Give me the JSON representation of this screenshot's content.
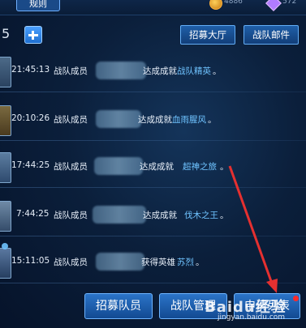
{
  "header": {
    "rules_label": "规则",
    "coins": "4886",
    "gems": "572"
  },
  "toolbar": {
    "count": "5",
    "recruit_hall_label": "招募大厅",
    "team_mail_label": "战队邮件"
  },
  "logs": [
    {
      "time": "21:45:13",
      "prefix": "战队成员",
      "suffix": "达成成就",
      "highlight": "战队精英",
      "end": "。"
    },
    {
      "time": "20:10:26",
      "prefix": "战队成员",
      "suffix": "达成成就",
      "highlight": "血雨腥风",
      "end": "。"
    },
    {
      "time": "17:44:25",
      "prefix": "战队成员",
      "suffix": "达成成就",
      "highlight": "超神之旅",
      "end": "。"
    },
    {
      "time": "7:44:25",
      "prefix": "战队成员",
      "suffix": "达成成就",
      "highlight": "伐木之王",
      "end": "。"
    },
    {
      "time": "15:11:05",
      "prefix": "战队成员",
      "suffix": "获得英雄",
      "highlight": "苏烈",
      "end": "。"
    }
  ],
  "bottom": {
    "recruit_members_label": "招募队员",
    "team_manage_label": "战队管理",
    "apply_list_label": "申请列表"
  },
  "watermark": {
    "main": "Baidu经验",
    "sub": "jingyan.baidu.com"
  },
  "colors": {
    "highlight": "#6fc3ff",
    "button": "#1f5fa8",
    "arrow": "#e53030"
  }
}
